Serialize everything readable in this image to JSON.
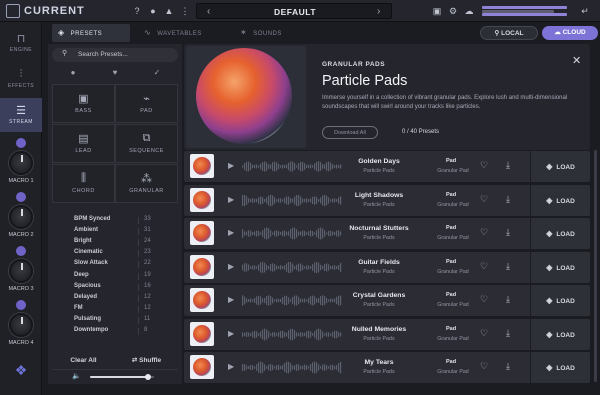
{
  "app": {
    "logo_text": "CURRENT",
    "preset_name": "DEFAULT",
    "prev_arrow": "‹",
    "next_arrow": "›",
    "help_icon_text": "?",
    "meter_levels": [
      0.97,
      0.82,
      0.97
    ]
  },
  "sidebar": {
    "nav": [
      {
        "label": "ENGINE",
        "icon": "engine-icon",
        "glyph": "⊓"
      },
      {
        "label": "EFFECTS",
        "icon": "sliders-icon",
        "glyph": "⫶"
      },
      {
        "label": "STREAM",
        "icon": "stream-icon",
        "glyph": "☰",
        "active": true
      }
    ],
    "macros": [
      {
        "label": "MACRO 1"
      },
      {
        "label": "MACRO 2"
      },
      {
        "label": "MACRO 3"
      },
      {
        "label": "MACRO 4"
      }
    ]
  },
  "tabs": [
    {
      "label": "PRESETS",
      "active": true
    },
    {
      "label": "WAVETABLES",
      "active": false
    },
    {
      "label": "SOUNDS",
      "active": false
    }
  ],
  "source": {
    "local": "LOCAL",
    "cloud": "CLOUD"
  },
  "browser": {
    "search_placeholder": "Search Presets...",
    "categories": [
      {
        "label": "BASS",
        "icon": "bass-icon",
        "glyph": "▣"
      },
      {
        "label": "PAD",
        "icon": "pad-icon",
        "glyph": "⌁"
      },
      {
        "label": "LEAD",
        "icon": "lead-icon",
        "glyph": "▤"
      },
      {
        "label": "SEQUENCE",
        "icon": "sequence-icon",
        "glyph": "⧉"
      },
      {
        "label": "CHORD",
        "icon": "chord-icon",
        "glyph": "⫼"
      },
      {
        "label": "GRANULAR",
        "icon": "granular-icon",
        "glyph": "⁂"
      }
    ],
    "tags": [
      {
        "name": "BPM Synced",
        "count": "33"
      },
      {
        "name": "Ambient",
        "count": "31"
      },
      {
        "name": "Bright",
        "count": "24"
      },
      {
        "name": "Cinematic",
        "count": "23"
      },
      {
        "name": "Slow Attack",
        "count": "22"
      },
      {
        "name": "Deep",
        "count": "19"
      },
      {
        "name": "Spacious",
        "count": "16"
      },
      {
        "name": "Delayed",
        "count": "12"
      },
      {
        "name": "FM",
        "count": "12"
      },
      {
        "name": "Pulsating",
        "count": "11"
      },
      {
        "name": "Downtempo",
        "count": "8"
      }
    ],
    "clear_all": "Clear All",
    "shuffle": "Shuffle",
    "volume": 0.9
  },
  "pack": {
    "kicker": "GRANULAR PADS",
    "title": "Particle Pads",
    "description": "Immerse yourself in a collection of vibrant granular pads. Explore lush and multi-dimensional soundscapes that will swirl around your tracks like particles.",
    "download_all": "Download All",
    "preset_count": "0 / 40 Presets",
    "close": "✕"
  },
  "presets": [
    {
      "name": "Golden Days",
      "pack": "Particle Pads",
      "type": "Pad",
      "sub": "Granular Pad",
      "load": "LOAD"
    },
    {
      "name": "Light Shadows",
      "pack": "Particle Pads",
      "type": "Pad",
      "sub": "Granular Pad",
      "load": "LOAD"
    },
    {
      "name": "Nocturnal Stutters",
      "pack": "Particle Pads",
      "type": "Pad",
      "sub": "Granular Pad",
      "load": "LOAD"
    },
    {
      "name": "Guitar Fields",
      "pack": "Particle Pads",
      "type": "Pad",
      "sub": "Granular Pad",
      "load": "LOAD"
    },
    {
      "name": "Crystal Gardens",
      "pack": "Particle Pads",
      "type": "Pad",
      "sub": "Granular Pad",
      "load": "LOAD"
    },
    {
      "name": "Nulled Memories",
      "pack": "Particle Pads",
      "type": "Pad",
      "sub": "Granular Pad",
      "load": "LOAD"
    },
    {
      "name": "My Tears",
      "pack": "Particle Pads",
      "type": "Pad",
      "sub": "Granular Pad",
      "load": "LOAD"
    }
  ],
  "colors": {
    "accent": "#7d73d6",
    "macro_dot": "#6f63c8",
    "panel": "#25262d",
    "row": "#2b2c34"
  }
}
